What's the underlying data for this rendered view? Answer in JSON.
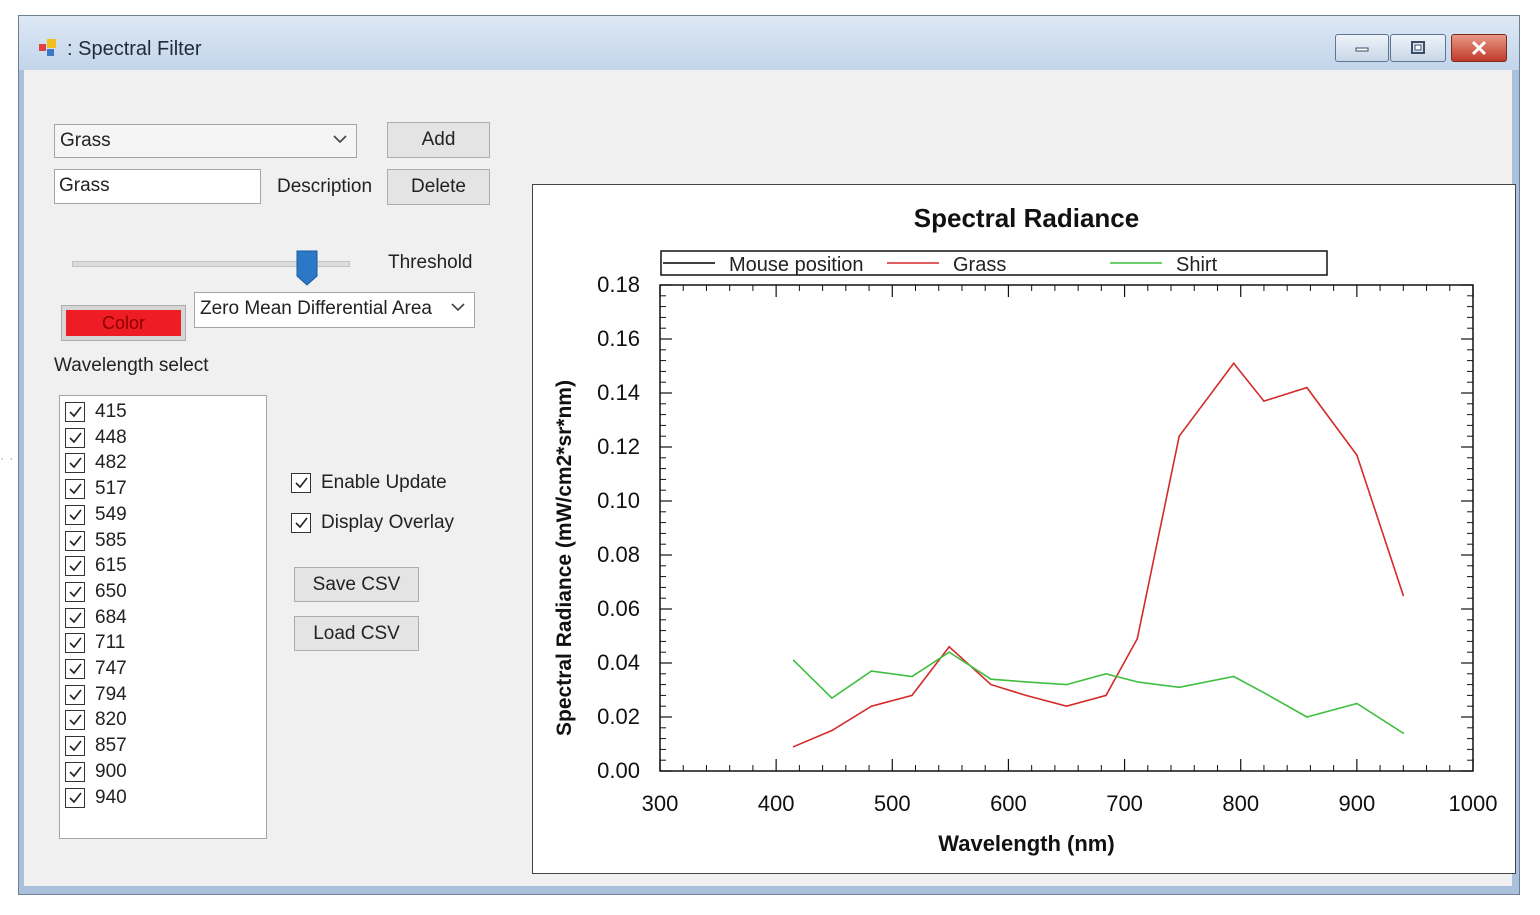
{
  "window": {
    "title": ": Spectral Filter",
    "icon": "app-icon"
  },
  "controls": {
    "material_combo": "Grass",
    "add_label": "Add",
    "name_field": "Grass",
    "description_label": "Description",
    "delete_label": "Delete",
    "threshold_label": "Threshold",
    "threshold_level": 0.88,
    "color_label": "Color",
    "color_value": "#ee1c25",
    "method_combo": "Zero Mean Differential Area",
    "wavelength_select_label": "Wavelength select",
    "enable_update": {
      "label": "Enable Update",
      "checked": true
    },
    "display_overlay": {
      "label": "Display Overlay",
      "checked": true
    },
    "save_csv_label": "Save CSV",
    "load_csv_label": "Load CSV"
  },
  "wavelengths": [
    {
      "label": "415",
      "checked": true
    },
    {
      "label": "448",
      "checked": true
    },
    {
      "label": "482",
      "checked": true
    },
    {
      "label": "517",
      "checked": true
    },
    {
      "label": "549",
      "checked": true
    },
    {
      "label": "585",
      "checked": true
    },
    {
      "label": "615",
      "checked": true
    },
    {
      "label": "650",
      "checked": true
    },
    {
      "label": "684",
      "checked": true
    },
    {
      "label": "711",
      "checked": true
    },
    {
      "label": "747",
      "checked": true
    },
    {
      "label": "794",
      "checked": true
    },
    {
      "label": "820",
      "checked": true
    },
    {
      "label": "857",
      "checked": true
    },
    {
      "label": "900",
      "checked": true
    },
    {
      "label": "940",
      "checked": true
    }
  ],
  "chart_data": {
    "type": "line",
    "title": "Spectral Radiance",
    "xlabel": "Wavelength (nm)",
    "ylabel": "Spectral Radiance (mW/cm2*sr*nm)",
    "xlim": [
      300,
      1000
    ],
    "ylim": [
      0,
      0.18
    ],
    "x_ticks": [
      "300",
      "400",
      "500",
      "600",
      "700",
      "800",
      "900",
      "1000"
    ],
    "y_ticks": [
      "0.00",
      "0.02",
      "0.04",
      "0.06",
      "0.08",
      "0.10",
      "0.12",
      "0.14",
      "0.16",
      "0.18"
    ],
    "legend_position": "top",
    "grid": false,
    "series": [
      {
        "name": "Mouse position",
        "color": "#000000",
        "x": [],
        "y": []
      },
      {
        "name": "Grass",
        "color": "#d42a2a",
        "x": [
          415,
          448,
          482,
          517,
          549,
          585,
          615,
          650,
          684,
          711,
          747,
          794,
          820,
          857,
          900,
          940
        ],
        "y": [
          0.009,
          0.015,
          0.024,
          0.028,
          0.046,
          0.032,
          0.028,
          0.024,
          0.028,
          0.049,
          0.124,
          0.151,
          0.137,
          0.142,
          0.117,
          0.065
        ]
      },
      {
        "name": "Shirt",
        "color": "#3fbf3f",
        "x": [
          415,
          448,
          482,
          517,
          549,
          585,
          615,
          650,
          684,
          711,
          747,
          794,
          820,
          857,
          900,
          940
        ],
        "y": [
          0.041,
          0.027,
          0.037,
          0.035,
          0.044,
          0.034,
          0.033,
          0.032,
          0.036,
          0.033,
          0.031,
          0.035,
          0.029,
          0.02,
          0.025,
          0.014
        ]
      }
    ]
  }
}
